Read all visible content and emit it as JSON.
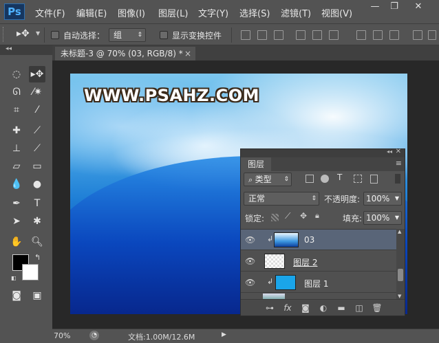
{
  "app": {
    "logo": "Ps"
  },
  "menu": [
    "文件(F)",
    "编辑(E)",
    "图像(I)",
    "图层(L)",
    "文字(Y)",
    "选择(S)",
    "滤镜(T)",
    "视图(V)"
  ],
  "window_controls": {
    "minimize": "—",
    "restore": "❐",
    "close": "✕"
  },
  "options": {
    "auto_select_label": "自动选择：",
    "auto_select_value": "组",
    "show_transform_label": "显示变换控件",
    "auto_select_checked": false,
    "show_transform_checked": false
  },
  "document": {
    "tab_title": "未标题-3 @ 70% (03, RGB/8) *",
    "tab_close": "×"
  },
  "canvas": {
    "watermark": "WWW.PSAHZ.COM"
  },
  "layers_panel": {
    "tab": "图层",
    "filter_kind": "类型",
    "blend_mode": "正常",
    "opacity_label": "不透明度:",
    "opacity_value": "100%",
    "lock_label": "锁定:",
    "fill_label": "填充:",
    "fill_value": "100%",
    "layers": [
      {
        "name": "03",
        "visible": true,
        "clipped": true,
        "selected": true
      },
      {
        "name": "图层 2",
        "visible": true,
        "clipped": false,
        "selected": false
      },
      {
        "name": "图层 1",
        "visible": true,
        "clipped": true,
        "selected": false
      }
    ]
  },
  "status": {
    "zoom": "70%",
    "doc_info": "文档:1.00M/12.6M"
  },
  "colors": {
    "foreground": "#000000",
    "background": "#ffffff",
    "ui_bg": "#535353",
    "selected_layer": "#596578"
  }
}
